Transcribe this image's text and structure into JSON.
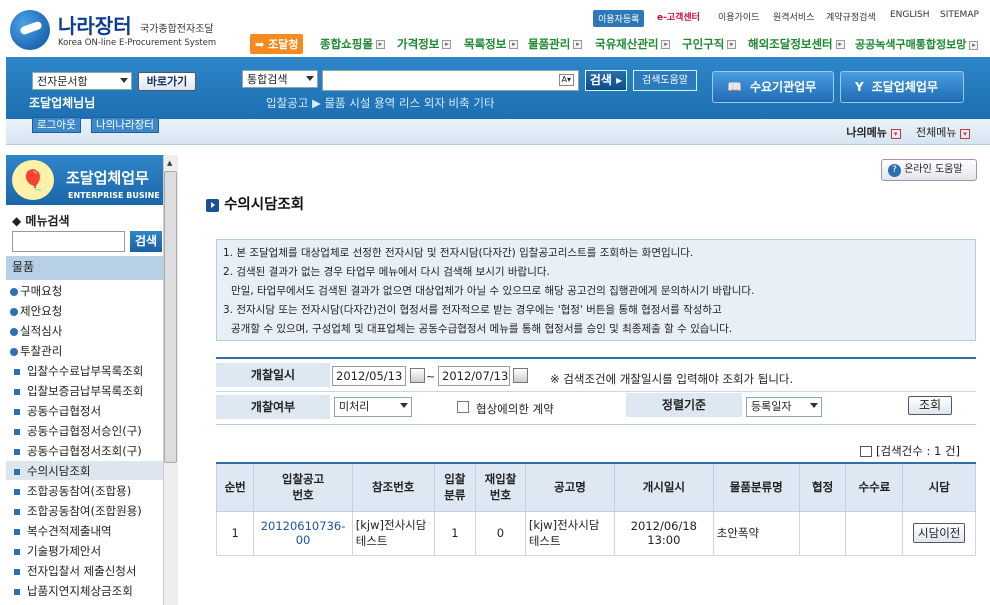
{
  "header": {
    "logo_title": "나라장터",
    "logo_subtitle": "국가종합전자조달",
    "logo_english": "Korea ON-line E-Procurement System",
    "util": {
      "register": "이용자등록",
      "e_center": "e-고객센터",
      "guide": "이용가이드",
      "remote": "원격서비스",
      "contract_rule": "계약규정검색",
      "english": "ENGLISH",
      "sitemap": "SITEMAP"
    },
    "gnb": [
      "조달청",
      "종합쇼핑몰",
      "가격정보",
      "목록정보",
      "물품관리",
      "국유재산관리",
      "구인구직",
      "해외조달정보센터",
      "공공녹색구매통합정보망"
    ]
  },
  "band": {
    "doc_select": "전자문서함",
    "go_button": "바로가기",
    "search_select": "통합검색",
    "search_placeholder": "",
    "search_button": "검색",
    "search_help": "검색도움말",
    "user_name": "조달업체님님",
    "quick_links": "입찰공고 ▶ 물품 시설 용역 리스 외자 비축 기타",
    "btn_demand": "수요기관업무",
    "btn_supplier": "조달업체업무",
    "logout": "로그아웃",
    "my_nara": "나의나라장터",
    "my_menu": "나의메뉴",
    "all_menu": "전체메뉴"
  },
  "sidebar": {
    "title": "조달업체업무",
    "title_en": "ENTERPRISE BUSINE",
    "menu_search_label": "◆ 메뉴검색",
    "search_btn": "검색",
    "category": "물품",
    "items": [
      {
        "label": "구매요청",
        "level": 1
      },
      {
        "label": "제안요청",
        "level": 1
      },
      {
        "label": "실적심사",
        "level": 1
      },
      {
        "label": "투찰관리",
        "level": 1
      },
      {
        "label": "입찰수수료납부목록조회",
        "level": 2
      },
      {
        "label": "입찰보증금납부목록조회",
        "level": 2
      },
      {
        "label": "공동수급협정서",
        "level": 2
      },
      {
        "label": "공동수급협정서승인(구)",
        "level": 2
      },
      {
        "label": "공동수급협정서조회(구)",
        "level": 2
      },
      {
        "label": "수의시담조회",
        "level": 2,
        "active": true
      },
      {
        "label": "조합공동참여(조합용)",
        "level": 2
      },
      {
        "label": "조합공동참여(조합원용)",
        "level": 2
      },
      {
        "label": "복수견적제출내역",
        "level": 2
      },
      {
        "label": "기술평가제안서",
        "level": 2
      },
      {
        "label": "전자입찰서 제출신청서",
        "level": 2
      },
      {
        "label": "납품지연지체상금조회",
        "level": 2
      }
    ]
  },
  "main": {
    "help_button": "온라인 도움말",
    "page_title": "수의시담조회",
    "info_lines": [
      "1. 본 조달업체를 대상업체로 선정한 전자시담 및 전자시담(다자간) 입찰공고리스트를 조회하는 화면입니다.",
      "2. 검색된 결과가 없는 경우 타업무 메뉴에서 다시 검색해 보시기 바랍니다.",
      "   만일, 타업무에서도 검색된 결과가 없으면 대상업체가 아닐 수 있으므로 해당 공고건의 집행관에게 문의하시기 바랍니다.",
      "3. 전자시담 또는 전자시담(다자간)건이 협정서를 전자적으로 받는 경우에는 '협정' 버튼을 통해 협정서를 작성하고",
      "   공개할 수 있으며, 구성업체 및 대표업체는 공동수급협정서 메뉴를 통해 협정서를 승인 및 최종제출 할 수 있습니다."
    ],
    "form": {
      "open_date_label": "개찰일시",
      "date_from": "2012/05/13",
      "tilde": "~",
      "date_to": "2012/07/13",
      "note": "※ 검색조건에 개찰일시를 입력해야 조회가 됩니다.",
      "open_status_label": "개찰여부",
      "open_status_value": "미처리",
      "negotiated_check": "협상에의한 계약",
      "sort_label": "정렬기준",
      "sort_value": "등록일자",
      "query_button": "조회"
    },
    "result_count": "[검색건수 : 1 건]",
    "table": {
      "headers": [
        "순번",
        "입찰공고\n번호",
        "참조번호",
        "입찰\n분류",
        "재입찰\n번호",
        "공고명",
        "개시일시",
        "물품분류명",
        "협정",
        "수수료",
        "시담"
      ],
      "rows": [
        {
          "no": "1",
          "bid_no": "20120610736-00",
          "ref_no": "[kjw]전사시담 테스트",
          "bid_class": "1",
          "rebid_no": "0",
          "notice_name": "[kjw]전사시담 테스트",
          "start_date": "2012/06/18 13:00",
          "category": "초안폭약",
          "agreement": "",
          "fee": "",
          "action": "시담이전"
        }
      ]
    }
  },
  "colors": {
    "brand_blue": "#1d6fb1",
    "gnb_green": "#1d8a2f",
    "accent_orange": "#f58a1f",
    "link_blue": "#1a53a6"
  }
}
